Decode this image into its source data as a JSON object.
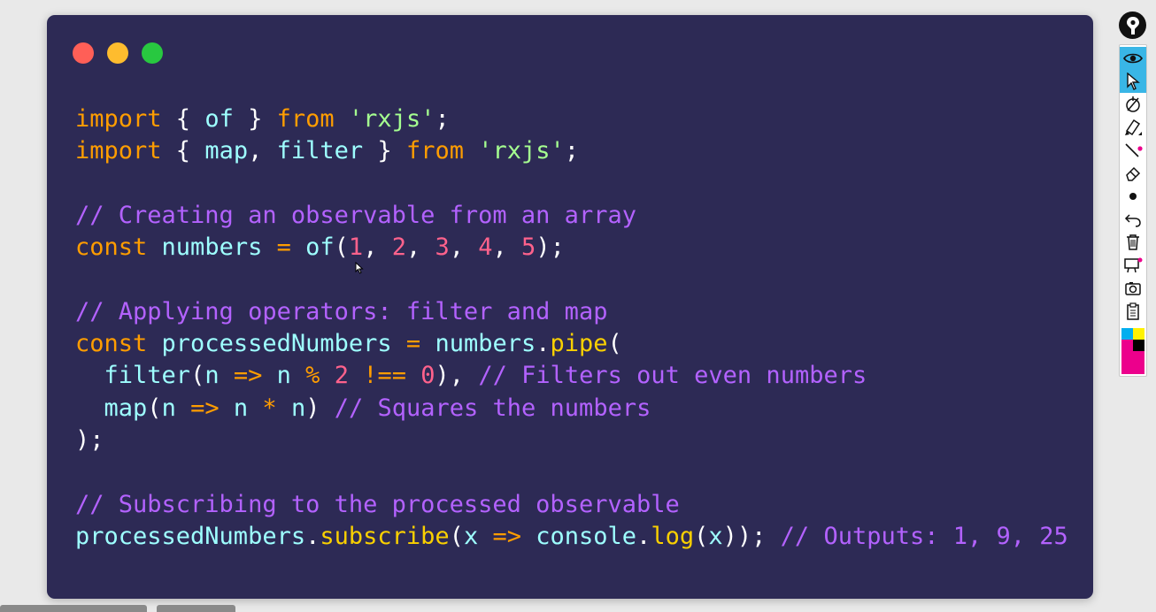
{
  "window": {
    "controls": [
      {
        "name": "close",
        "color": "#ff5f57"
      },
      {
        "name": "minimize",
        "color": "#febc2e"
      },
      {
        "name": "maximize",
        "color": "#28c840"
      }
    ]
  },
  "code": {
    "language": "javascript",
    "lines": [
      [
        [
          "kw",
          "import"
        ],
        [
          "p",
          " { "
        ],
        [
          "id",
          "of"
        ],
        [
          "p",
          " } "
        ],
        [
          "kw",
          "from"
        ],
        [
          "p",
          " "
        ],
        [
          "str",
          "'rxjs'"
        ],
        [
          "p",
          ";"
        ]
      ],
      [
        [
          "kw",
          "import"
        ],
        [
          "p",
          " { "
        ],
        [
          "id",
          "map"
        ],
        [
          "p",
          ", "
        ],
        [
          "id",
          "filter"
        ],
        [
          "p",
          " } "
        ],
        [
          "kw",
          "from"
        ],
        [
          "p",
          " "
        ],
        [
          "str",
          "'rxjs'"
        ],
        [
          "p",
          ";"
        ]
      ],
      [],
      [
        [
          "cm",
          "// Creating an observable from an array"
        ]
      ],
      [
        [
          "kw",
          "const"
        ],
        [
          "p",
          " "
        ],
        [
          "id",
          "numbers"
        ],
        [
          "p",
          " "
        ],
        [
          "op",
          "="
        ],
        [
          "p",
          " "
        ],
        [
          "id",
          "of"
        ],
        [
          "p",
          "("
        ],
        [
          "num",
          "1"
        ],
        [
          "p",
          ", "
        ],
        [
          "num",
          "2"
        ],
        [
          "p",
          ", "
        ],
        [
          "num",
          "3"
        ],
        [
          "p",
          ", "
        ],
        [
          "num",
          "4"
        ],
        [
          "p",
          ", "
        ],
        [
          "num",
          "5"
        ],
        [
          "p",
          ");"
        ]
      ],
      [],
      [
        [
          "cm",
          "// Applying operators: filter and map"
        ]
      ],
      [
        [
          "kw",
          "const"
        ],
        [
          "p",
          " "
        ],
        [
          "id",
          "processedNumbers"
        ],
        [
          "p",
          " "
        ],
        [
          "op",
          "="
        ],
        [
          "p",
          " "
        ],
        [
          "id",
          "numbers"
        ],
        [
          "p",
          "."
        ],
        [
          "fn",
          "pipe"
        ],
        [
          "p",
          "("
        ]
      ],
      [
        [
          "p",
          "  "
        ],
        [
          "id",
          "filter"
        ],
        [
          "p",
          "("
        ],
        [
          "id",
          "n"
        ],
        [
          "p",
          " "
        ],
        [
          "op",
          "=>"
        ],
        [
          "p",
          " "
        ],
        [
          "id",
          "n"
        ],
        [
          "p",
          " "
        ],
        [
          "op",
          "%"
        ],
        [
          "p",
          " "
        ],
        [
          "num",
          "2"
        ],
        [
          "p",
          " "
        ],
        [
          "op",
          "!=="
        ],
        [
          "p",
          " "
        ],
        [
          "num",
          "0"
        ],
        [
          "p",
          "), "
        ],
        [
          "cm",
          "// Filters out even numbers"
        ]
      ],
      [
        [
          "p",
          "  "
        ],
        [
          "id",
          "map"
        ],
        [
          "p",
          "("
        ],
        [
          "id",
          "n"
        ],
        [
          "p",
          " "
        ],
        [
          "op",
          "=>"
        ],
        [
          "p",
          " "
        ],
        [
          "id",
          "n"
        ],
        [
          "p",
          " "
        ],
        [
          "op",
          "*"
        ],
        [
          "p",
          " "
        ],
        [
          "id",
          "n"
        ],
        [
          "p",
          ") "
        ],
        [
          "cm",
          "// Squares the numbers"
        ]
      ],
      [
        [
          "p",
          ");"
        ]
      ],
      [],
      [
        [
          "cm",
          "// Subscribing to the processed observable"
        ]
      ],
      [
        [
          "id",
          "processedNumbers"
        ],
        [
          "p",
          "."
        ],
        [
          "fn",
          "subscribe"
        ],
        [
          "p",
          "("
        ],
        [
          "id",
          "x"
        ],
        [
          "p",
          " "
        ],
        [
          "op",
          "=>"
        ],
        [
          "p",
          " "
        ],
        [
          "id",
          "console"
        ],
        [
          "p",
          "."
        ],
        [
          "fn",
          "log"
        ],
        [
          "p",
          "("
        ],
        [
          "id",
          "x"
        ],
        [
          "p",
          "));"
        ],
        [
          "p",
          " "
        ],
        [
          "cm",
          "// Outputs: 1, 9, 25"
        ]
      ]
    ]
  },
  "toolbar": {
    "pin_icon": "pin-icon",
    "tools": [
      {
        "name": "eye-icon",
        "active": true
      },
      {
        "name": "pointer-icon",
        "active": true
      },
      {
        "name": "pen-off-icon",
        "active": false
      },
      {
        "name": "highlighter-icon",
        "active": false
      },
      {
        "name": "line-icon",
        "active": false
      },
      {
        "name": "eraser-icon",
        "active": false
      },
      {
        "name": "dot-icon",
        "active": false
      },
      {
        "name": "undo-icon",
        "active": false
      },
      {
        "name": "trash-icon",
        "active": false
      },
      {
        "name": "whiteboard-icon",
        "active": false
      },
      {
        "name": "camera-icon",
        "active": false
      },
      {
        "name": "clipboard-icon",
        "active": false
      }
    ],
    "palette": [
      "#00aeef",
      "#fff200",
      "#ec008c",
      "#000000"
    ]
  }
}
